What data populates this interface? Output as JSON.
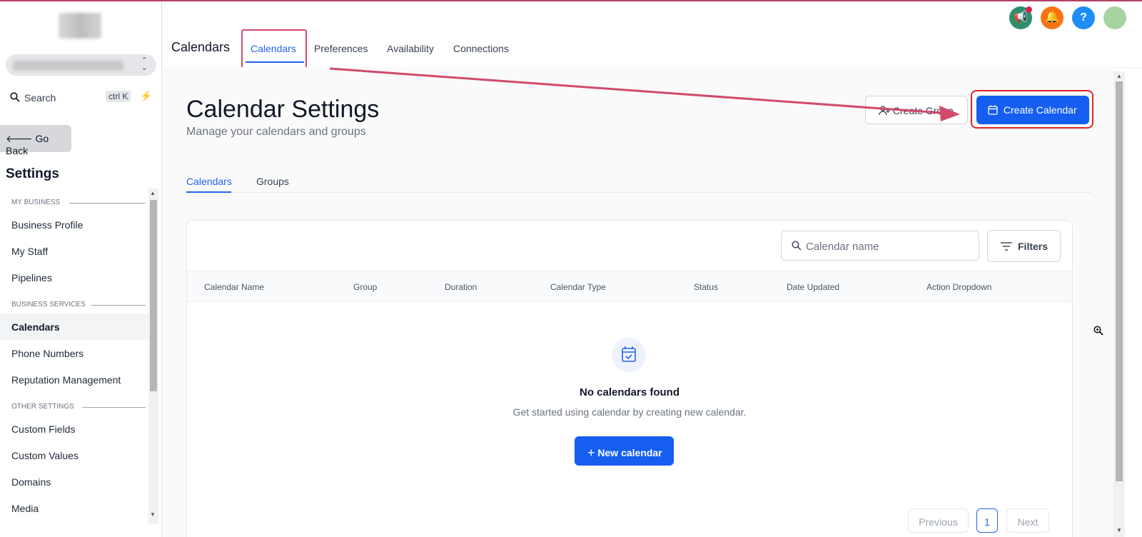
{
  "header": {
    "title": "Calendars",
    "tabs": [
      "Calendars",
      "Preferences",
      "Availability",
      "Connections"
    ],
    "icon_colors": [
      "#2f8f6b",
      "#f97316",
      "#1d8ef5",
      "#a7d3a2"
    ]
  },
  "sidebar": {
    "search_label": "Search",
    "shortcut": "ctrl K",
    "go_back": "Go Back",
    "title": "Settings",
    "sections": [
      {
        "label": "MY BUSINESS",
        "items": [
          "Business Profile",
          "My Staff",
          "Pipelines"
        ]
      },
      {
        "label": "BUSINESS SERVICES",
        "items": [
          "Calendars",
          "Phone Numbers",
          "Reputation Management"
        ]
      },
      {
        "label": "OTHER SETTINGS",
        "items": [
          "Custom Fields",
          "Custom Values",
          "Domains",
          "Media"
        ]
      }
    ],
    "active_item": "Calendars"
  },
  "page": {
    "title": "Calendar Settings",
    "subtitle": "Manage your calendars and groups",
    "create_group": "Create Group",
    "create_calendar": "Create Calendar",
    "sub_tabs": [
      "Calendars",
      "Groups"
    ]
  },
  "table": {
    "search_placeholder": "Calendar name",
    "filters": "Filters",
    "columns": [
      "Calendar Name",
      "Group",
      "Duration",
      "Calendar Type",
      "Status",
      "Date Updated",
      "Action Dropdown"
    ],
    "empty_title": "No calendars found",
    "empty_subtitle": "Get started using calendar by creating new calendar.",
    "new_button": "New calendar"
  },
  "pagination": {
    "previous": "Previous",
    "current": "1",
    "next": "Next"
  },
  "colors": {
    "primary": "#155eef",
    "annotation": "#d14a6c"
  }
}
